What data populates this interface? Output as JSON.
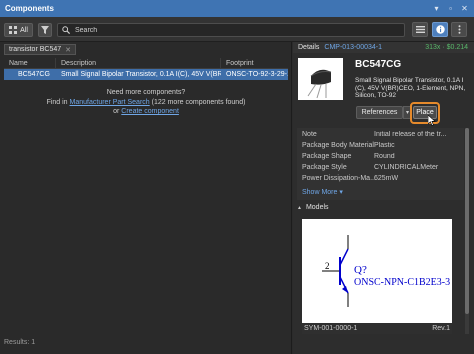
{
  "window": {
    "title": "Components"
  },
  "toolbar": {
    "all_label": "All",
    "search_placeholder": "Search"
  },
  "filter_chip": {
    "label": "transistor BC547"
  },
  "table": {
    "headers": [
      "Name",
      "Description",
      "Footprint"
    ],
    "selected_row": {
      "name": "BC547CG",
      "description": "Small Signal Bipolar Transistor, 0.1A I(C), 45V V(BR)CEO,...",
      "footprint": "ONSC-TO-92-3-29-11"
    }
  },
  "more": {
    "line1": "Need more components?",
    "line2_prefix": "Find in",
    "link1": "Manufacturer Part Search",
    "line2_suffix": "(122 more components found)",
    "or": "or",
    "link2": "Create component"
  },
  "status": {
    "text": "Results: 1"
  },
  "details": {
    "header_label": "Details",
    "component_id": "CMP-013-00034-1",
    "price": "313x · $0.214",
    "name": "BC547CG",
    "description": "Small Signal Bipolar Transistor, 0.1A I (C), 45V V(BR)CEO, 1-Element, NPN, Silicon, TO-92",
    "references_label": "References",
    "place_label": "Place"
  },
  "properties": [
    {
      "key": "Note",
      "value": "Initial release of the tr..."
    },
    {
      "key": "Package Body Material",
      "value": "Plastic"
    },
    {
      "key": "Package Shape",
      "value": "Round"
    },
    {
      "key": "Package Style",
      "value": "CYLINDRICALMeter"
    },
    {
      "key": "Power Dissipation-Ma...",
      "value": "625mW"
    }
  ],
  "show_more": "Show More",
  "models": {
    "title": "Models",
    "symbol_designator": "Q?",
    "symbol_comment": "ONSC-NPN-C1B2E3-3",
    "pin_number": "2",
    "symbol_id": "SYM-001-0000-1",
    "revision": "Rev.1"
  },
  "colors": {
    "titlebar": "#3f74b3",
    "selection": "#3e6ea9",
    "link": "#6fa6e6",
    "price": "#59b86a",
    "highlight": "#e58a2c"
  }
}
